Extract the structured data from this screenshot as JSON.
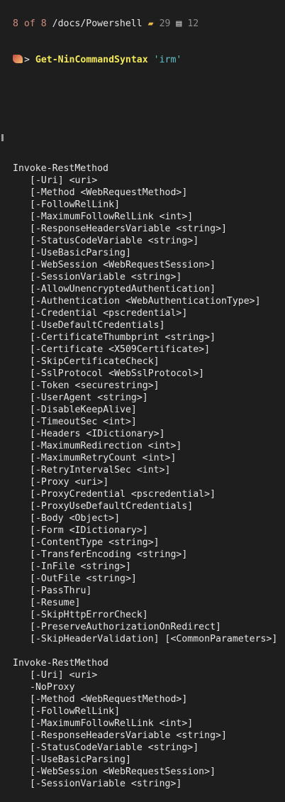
{
  "status": {
    "position": "8",
    "of_word": "of",
    "total": "8",
    "path": "/docs/Powershell",
    "folder_count": "29",
    "file_count": "12"
  },
  "prompt": {
    "arrow": "> ",
    "command": "Get-NinCommandSyntax",
    "argument": "'irm'"
  },
  "syntax_sets": [
    {
      "command": "Invoke-RestMethod",
      "params": [
        "[-Uri] <uri>",
        "[-Method <WebRequestMethod>]",
        "[-FollowRelLink]",
        "[-MaximumFollowRelLink <int>]",
        "[-ResponseHeadersVariable <string>]",
        "[-StatusCodeVariable <string>]",
        "[-UseBasicParsing]",
        "[-WebSession <WebRequestSession>]",
        "[-SessionVariable <string>]",
        "[-AllowUnencryptedAuthentication]",
        "[-Authentication <WebAuthenticationType>]",
        "[-Credential <pscredential>]",
        "[-UseDefaultCredentials]",
        "[-CertificateThumbprint <string>]",
        "[-Certificate <X509Certificate>]",
        "[-SkipCertificateCheck]",
        "[-SslProtocol <WebSslProtocol>]",
        "[-Token <securestring>]",
        "[-UserAgent <string>]",
        "[-DisableKeepAlive]",
        "[-TimeoutSec <int>]",
        "[-Headers <IDictionary>]",
        "[-MaximumRedirection <int>]",
        "[-MaximumRetryCount <int>]",
        "[-RetryIntervalSec <int>]",
        "[-Proxy <uri>]",
        "[-ProxyCredential <pscredential>]",
        "[-ProxyUseDefaultCredentials]",
        "[-Body <Object>]",
        "[-Form <IDictionary>]",
        "[-ContentType <string>]",
        "[-TransferEncoding <string>]",
        "[-InFile <string>]",
        "[-OutFile <string>]",
        "[-PassThru]",
        "[-Resume]",
        "[-SkipHttpErrorCheck]",
        "[-PreserveAuthorizationOnRedirect]",
        "[-SkipHeaderValidation] [<CommonParameters>]"
      ]
    },
    {
      "command": "Invoke-RestMethod",
      "params": [
        "[-Uri] <uri>",
        "-NoProxy",
        "[-Method <WebRequestMethod>]",
        "[-FollowRelLink]",
        "[-MaximumFollowRelLink <int>]",
        "[-ResponseHeadersVariable <string>]",
        "[-StatusCodeVariable <string>]",
        "[-UseBasicParsing]",
        "[-WebSession <WebRequestSession>]",
        "[-SessionVariable <string>]"
      ]
    }
  ]
}
